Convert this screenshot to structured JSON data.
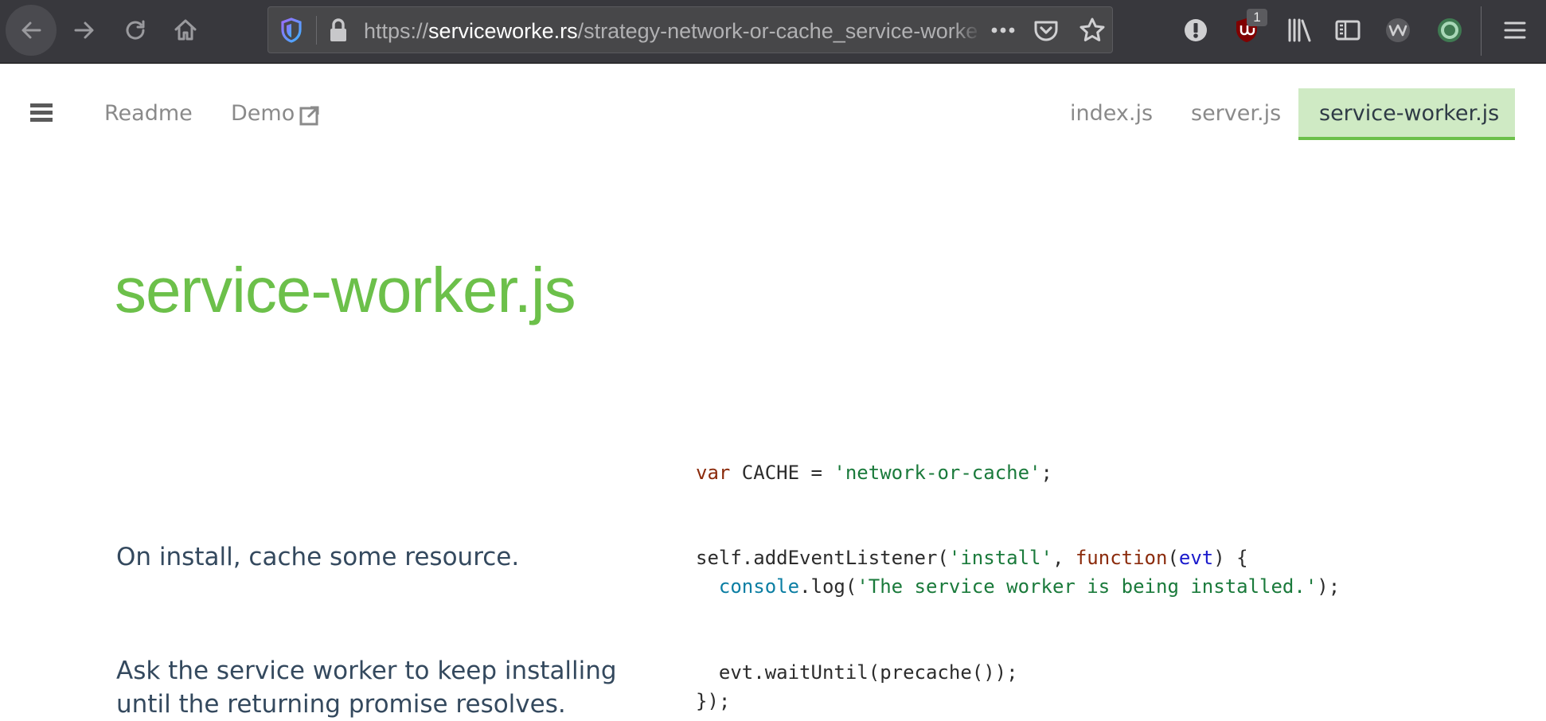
{
  "browser": {
    "url_scheme": "https://",
    "url_domain": "serviceworke.rs",
    "url_path": "/strategy-network-or-cache_service-worker_doc.html",
    "badge_count": "1"
  },
  "nav": {
    "readme": "Readme",
    "demo": "Demo",
    "tabs": [
      "index.js",
      "server.js",
      "service-worker.js"
    ]
  },
  "page": {
    "title": "service-worker.js",
    "sections": [
      {
        "text": "On install, cache some resource."
      },
      {
        "text": "Ask the service worker to keep installing until the returning promise resolves."
      }
    ]
  },
  "code": {
    "line_var_kw": "var",
    "line_var_name": " CACHE = ",
    "line_var_str": "'network-or-cache'",
    "line_var_end": ";",
    "l2_a": "self.addEventListener(",
    "l2_str": "'install'",
    "l2_b": ", ",
    "l2_kw": "function",
    "l2_c": "(",
    "l2_param": "evt",
    "l2_d": ") {",
    "l3_indent": "  ",
    "l3_builtin": "console",
    "l3_a": ".log(",
    "l3_str": "'The service worker is being installed.'",
    "l3_b": ");",
    "l4": "  evt.waitUntil(precache());",
    "l5": "});"
  },
  "colors": {
    "accent": "#6cc04a",
    "tab_active_bg": "#cfeac4",
    "chrome_bg": "#38383d",
    "text": "#34495e"
  }
}
